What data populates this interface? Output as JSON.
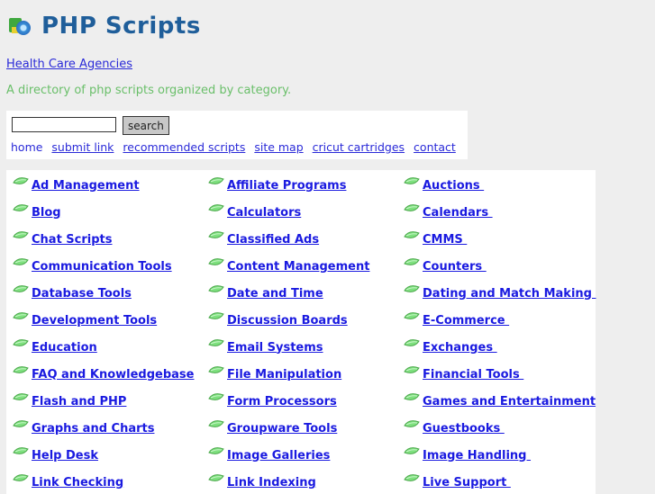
{
  "header": {
    "title": "PHP Scripts",
    "logo_icon": "php-scripts-logo-icon"
  },
  "agency_link": "Health Care Agencies",
  "tagline": "A directory of php scripts organized by category.",
  "search": {
    "value": "",
    "placeholder": "",
    "button_label": "search"
  },
  "nav": [
    "home",
    "submit link",
    "recommended scripts",
    "site map",
    "cricut cartridges",
    "contact"
  ],
  "categories": {
    "col1": [
      "Ad Management",
      "Blog",
      "Chat Scripts",
      "Communication Tools",
      "Database Tools",
      "Development Tools",
      "Education",
      "FAQ and Knowledgebase",
      "Flash and PHP",
      "Graphs and Charts",
      "Help Desk",
      "Link Checking"
    ],
    "col2": [
      "Affiliate Programs",
      "Calculators",
      "Classified Ads",
      "Content Management",
      "Date and Time",
      "Discussion Boards",
      "Email Systems",
      "File Manipulation",
      "Form Processors",
      "Groupware Tools",
      "Image Galleries",
      "Link Indexing"
    ],
    "col3": [
      "Auctions ",
      "Calendars ",
      "CMMS ",
      "Counters ",
      "Dating and Match Making ",
      "E-Commerce ",
      "Exchanges ",
      "Financial Tools ",
      "Games and Entertainment",
      "Guestbooks ",
      "Image Handling ",
      "Live Support "
    ]
  },
  "colors": {
    "title": "#1f5e9a",
    "link": "#1a1ae0",
    "tagline": "#6abf6a",
    "background": "#eeeeee"
  }
}
